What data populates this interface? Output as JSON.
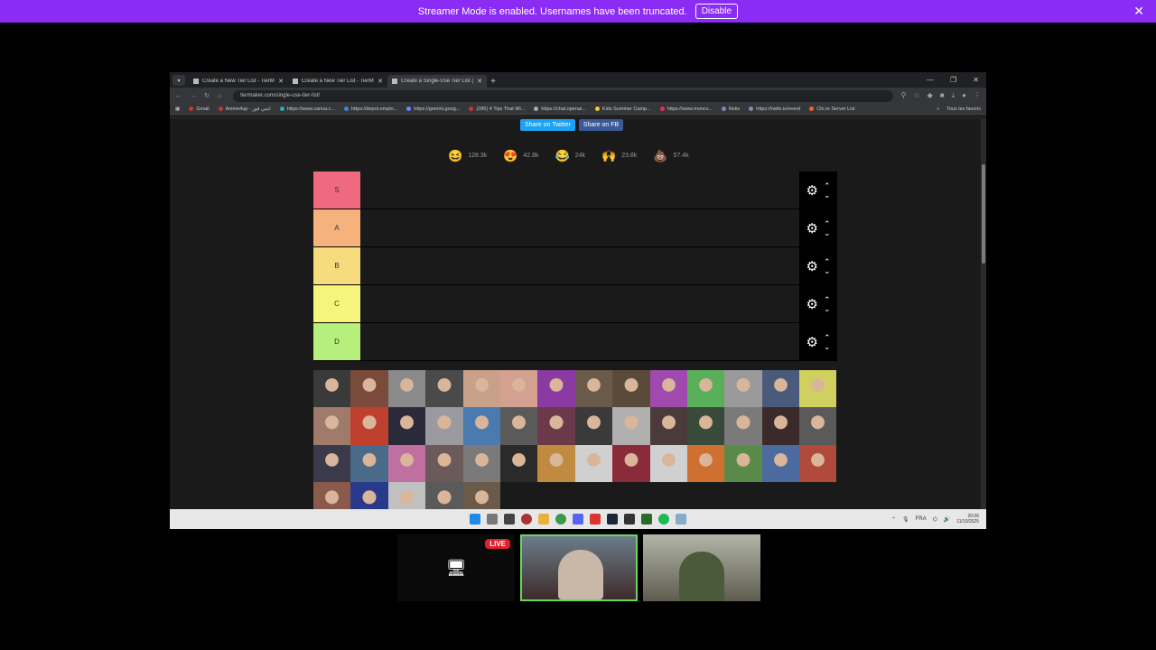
{
  "streamer_bar": {
    "message": "Streamer Mode is enabled. Usernames have been truncated.",
    "disable_label": "Disable",
    "close_glyph": "✕"
  },
  "tabs": [
    {
      "label": "Create a New Tier List - TierMa",
      "close": "✕"
    },
    {
      "label": "Create a New Tier List - TierMa",
      "close": "✕"
    },
    {
      "label": "Create a Single-Use Tier List (T",
      "close": "✕"
    }
  ],
  "new_tab_glyph": "+",
  "window_controls": {
    "minimize": "—",
    "maximize": "❐",
    "close": "✕"
  },
  "address": {
    "url": "tiermaker.com/single-use-tier-list/"
  },
  "bookmarks": [
    "Gmail",
    "Anime4up - انمي فور",
    "https://www.canva.c...",
    "https://depot.emplo...",
    "https://gemini.goog...",
    "(286) 4 Tips That Wi...",
    "https://chat.openai...",
    "Kids Summer Camp...",
    "https://www.moncv...",
    "Netix",
    "https://netix.io/event",
    "Cfx.re Server List"
  ],
  "bookmarks_right": "Tous les favoris",
  "share": {
    "twitter": "Share on Twitter",
    "fb": "Share on FB"
  },
  "reactions": [
    {
      "emoji": "😆",
      "count": "128.3k"
    },
    {
      "emoji": "😍",
      "count": "42.8k"
    },
    {
      "emoji": "😂",
      "count": "24k"
    },
    {
      "emoji": "🙌",
      "count": "23.8k"
    },
    {
      "emoji": "💩",
      "count": "57.4k"
    }
  ],
  "tiers": [
    {
      "label": "S",
      "color": "#ef6a7e"
    },
    {
      "label": "A",
      "color": "#f6b27c"
    },
    {
      "label": "B",
      "color": "#f6dc7c"
    },
    {
      "label": "C",
      "color": "#f5f57c"
    },
    {
      "label": "D",
      "color": "#b6ef7c"
    }
  ],
  "tier_controls": {
    "gear": "⚙",
    "up": "⌃",
    "down": "⌄"
  },
  "pool_colors": [
    "#3a3a3a",
    "#7a4a3a",
    "#8a8a8a",
    "#4a4a4a",
    "#c9a08a",
    "#d4a090",
    "#8a3aa0",
    "#6a5a4a",
    "#5a4a3a",
    "#a04ab0",
    "#5ab05a",
    "#9a9a9a",
    "#4a5a7a",
    "#d0d060",
    "#a07a6a",
    "#c04030",
    "#2a2a3a",
    "#9a9aa0",
    "#4a7ab0",
    "#5a5a5a",
    "#6a3a4a",
    "#3a3a3a",
    "#b0b0b0",
    "#4a3a3a",
    "#3a4a3a",
    "#7a7a7a",
    "#3a2a2a",
    "#5a5a5a",
    "#3a3a4a",
    "#4a6a8a",
    "#c070a0",
    "#6a5a5a",
    "#7a7a7a",
    "#2a2a2a",
    "#c08a40",
    "#d0d0d0",
    "#8a2a3a",
    "#d0d0d0",
    "#d07030",
    "#5a8a4a",
    "#4a6aa0",
    "#b04a3a",
    "#8a5a4a",
    "#2a3a8a",
    "#c0c0c0",
    "#5a5a5a",
    "#6a5a4a"
  ],
  "taskbar": {
    "tray_text": "FRA",
    "clock_time": "20:06",
    "clock_date": "11/10/2025"
  },
  "live_badge": "LIVE",
  "screen_glyph": "🖥"
}
